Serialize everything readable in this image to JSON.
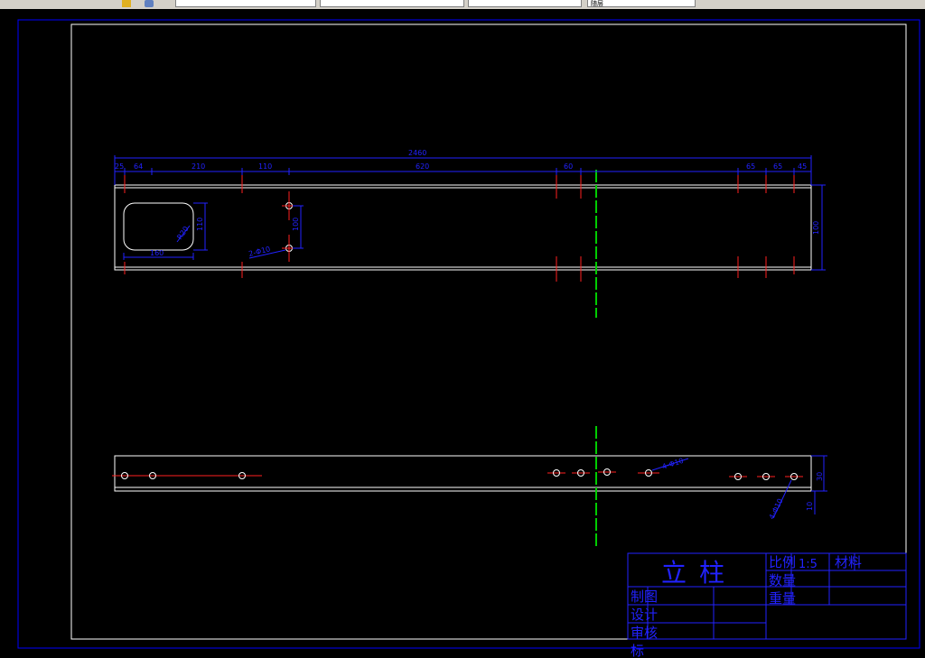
{
  "toolbar": {
    "icons": [
      "layer-tool-icon",
      "3d-orbit-icon"
    ],
    "fields": [
      "",
      "",
      "",
      "随层"
    ]
  },
  "title_block": {
    "part_name": "立柱",
    "scale_label": "比例",
    "scale_value": "1:5",
    "material_label": "材料",
    "quantity_label": "数量",
    "weight_label": "重量",
    "drawn_label": "制图",
    "designed_label": "设计",
    "checked_label": "审核",
    "standard_label": "标"
  },
  "dimensions": {
    "overall": "2460",
    "d1": "25",
    "d2": "64",
    "d3": "210",
    "d4": "110",
    "d5": "620",
    "d6": "60",
    "d7": "65",
    "d8": "65",
    "d9": "45",
    "height": "100",
    "hole_spacing": "100",
    "slot_height": "110",
    "slot_width": "160",
    "slot_radius": "R20",
    "hole_note": "2-Φ10",
    "hole_note_2": "4-Φ10",
    "hole_note_3": "4-Φ10",
    "side_height": "30",
    "side_gap": "10"
  },
  "colors": {
    "background": "#000000",
    "frame": "#ffffff",
    "border": "#0000ff",
    "dimension": "#2222ff",
    "centerline": "#ff2020",
    "section": "#00cc00",
    "hole": "#ffffff"
  }
}
